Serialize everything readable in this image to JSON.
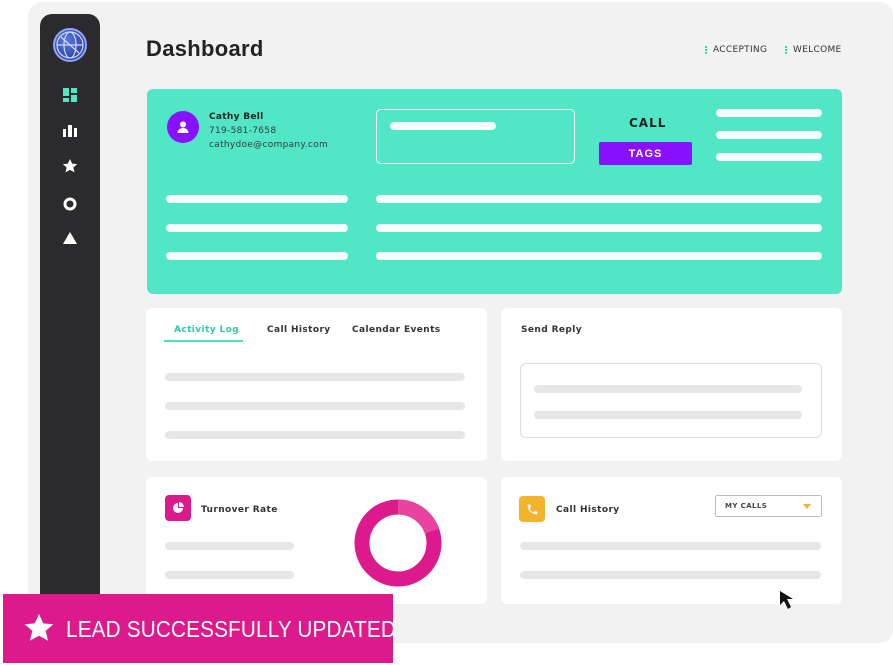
{
  "page_title": "Dashboard",
  "header": {
    "status_accepting": "ACCEPTING",
    "status_welcome": "WELCOME"
  },
  "contact": {
    "name": "Cathy Bell",
    "phone": "719-581-7658",
    "email": "cathydoe@company.com",
    "call_label": "CALL",
    "tags_label": "TAGS"
  },
  "tabs": {
    "activity_log": "Activity Log",
    "call_history": "Call History",
    "calendar_events": "Calendar Events"
  },
  "send_reply": {
    "title": "Send Reply"
  },
  "turnover": {
    "title": "Turnover Rate"
  },
  "call_history_card": {
    "title": "Call History",
    "select_value": "MY CALLS"
  },
  "toast": {
    "message": "LEAD SUCCESSFULLY UPDATED"
  },
  "colors": {
    "accent_teal": "#51e6c6",
    "accent_purple": "#8a11ff",
    "accent_pink": "#dc1a8c",
    "accent_yellow": "#f3b32b",
    "sidebar": "#2b2b2d"
  },
  "icons": {
    "sidebar": [
      "globe-logo-icon",
      "dashboard-icon",
      "bar-chart-icon",
      "star-icon",
      "circle-icon",
      "triangle-icon"
    ],
    "toast": "star-icon",
    "turnover": "pie-chart-icon",
    "call_history": "phone-icon"
  }
}
